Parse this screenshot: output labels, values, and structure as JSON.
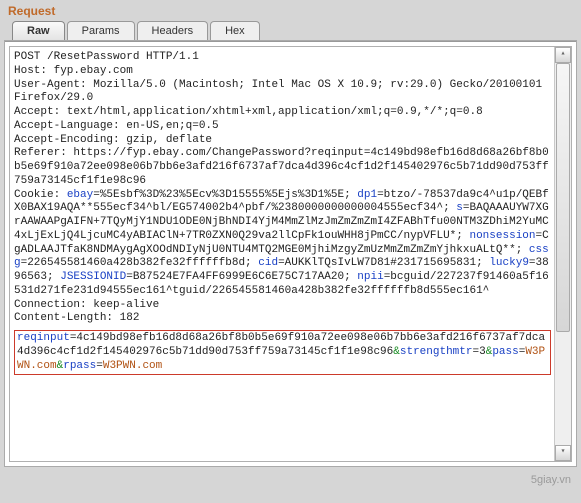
{
  "panel": {
    "title": "Request"
  },
  "tabs": {
    "items": [
      {
        "label": "Raw"
      },
      {
        "label": "Params"
      },
      {
        "label": "Headers"
      },
      {
        "label": "Hex"
      }
    ]
  },
  "http": {
    "request_line": "POST /ResetPassword HTTP/1.1",
    "host": "Host: fyp.ebay.com",
    "ua": "User-Agent: Mozilla/5.0 (Macintosh; Intel Mac OS X 10.9; rv:29.0) Gecko/20100101 Firefox/29.0",
    "accept": "Accept: text/html,application/xhtml+xml,application/xml;q=0.9,*/*;q=0.8",
    "accept_lang": "Accept-Language: en-US,en;q=0.5",
    "accept_enc": "Accept-Encoding: gzip, deflate",
    "referer_label": "Referer: ",
    "referer_val": "https://fyp.ebay.com/ChangePassword?reqinput=4c149bd98efb16d8d68a26bf8b0b5e69f910a72ee098e06b7bb6e3afd216f6737af7dca4d396c4cf1d2f145402976c5b71dd90d753ff759a73145cf1f1e98c96",
    "cookie_label": "Cookie: ",
    "cookie_ebay_k": "ebay",
    "cookie_ebay_v": "=%5Esbf%3D%23%5Ecv%3D15555%5Ejs%3D1%5E",
    "dp1_k": "dp1",
    "dp1_v": "=btzo/-78537da9c4^u1p/QEBfX0BAX19AQA**555ecf34^bl/EG574002b4^pbf/%2380000000000004555ecf34^",
    "s_k": "s",
    "s_v": "=BAQAAAUYW7XGrAAWAAPgAIFN+7TQyMjY1NDU1ODE0NjBhNDI4YjM4MmZlMzJmZmZmZmI4ZFABhTfu00NTM3ZDhiM2YuMC4xLjExLjQ4LjcuMC4yABIAClN+7TR0ZXN0Q29va2llCpFk1ouWHH8jPmCC/nypVFLU*",
    "nonsession_k": "nonsession",
    "nonsession_v": "=CgADLAAJTfaK8NDMAygAgXOOdNDIyNjU0NTU4MTQ2MGE0MjhiMzgyZmUzMmZmZmZmYjhkxuALtQ**",
    "cssg_k": "cssg",
    "cssg_v": "=226545581460a428b382fe32ffffffb8d",
    "cid_k": "cid",
    "cid_v": "=AUKKlTQsIvLW7D81#231715695831",
    "lucky9_k": "lucky9",
    "lucky9_v": "=3896563",
    "jsession_k": "JSESSIONID",
    "jsession_v": "=B87524E7FA4FF6999E6C6E75C717AA20",
    "npii_k": "npii",
    "npii_v": "=bcguid/227237f91460a5f16531d271fe231d94555ec161^tguid/226545581460a428b382fe32ffffffb8d555ec161^",
    "connection": "Connection: keep-alive",
    "content_length": "Content-Length: 182",
    "body_reqinput_k": "reqinput",
    "body_reqinput_v": "=4c149bd98efb16d8d68a26bf8b0b5e69f910a72ee098e06b7bb6e3afd216f6737af7dca4d396c4cf1d2f145402976c5b71dd90d753ff759a73145cf1f1e98c96",
    "amp1": "&",
    "body_strength_k": "strengthmtr",
    "body_strength_v": "=3",
    "amp2": "&",
    "body_pass_k": "pass",
    "body_pass_v": "=",
    "body_pass_val": "W3PWN.com",
    "amp3": "&",
    "body_rpass_k": "rpass",
    "body_rpass_v": "=",
    "body_rpass_val": "W3PWN.com"
  },
  "footer": {
    "watermark": "5giay.vn"
  }
}
